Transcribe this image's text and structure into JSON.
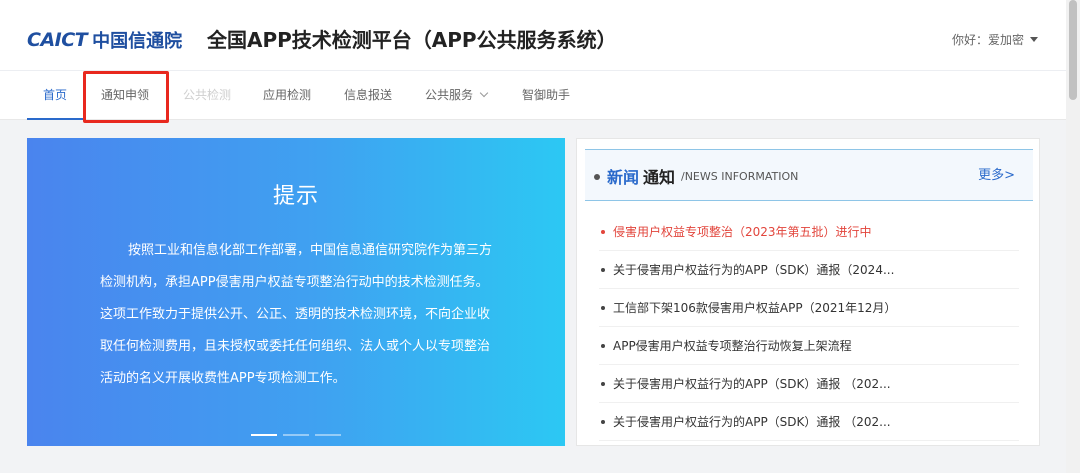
{
  "header": {
    "logo_latin": "CAICT",
    "logo_cn": "中国信通院",
    "title": "全国APP技术检测平台（APP公共服务系统）",
    "user_greeting": "你好：爱加密"
  },
  "nav": {
    "items": [
      {
        "label": "首页",
        "state": "active"
      },
      {
        "label": "通知申领",
        "state": "highlighted"
      },
      {
        "label": "公共检测",
        "state": "disabled"
      },
      {
        "label": "应用检测",
        "state": "normal"
      },
      {
        "label": "信息报送",
        "state": "normal"
      },
      {
        "label": "公共服务",
        "state": "dropdown"
      },
      {
        "label": "智御助手",
        "state": "normal"
      }
    ],
    "highlight_color": "#e8281e"
  },
  "banner": {
    "title": "提示",
    "body": "按照工业和信息化部工作部署，中国信息通信研究院作为第三方检测机构，承担APP侵害用户权益专项整治行动中的技术检测任务。这项工作致力于提供公开、公正、透明的技术检测环境，不向企业收取任何检测费用，且未授权或委托任何组织、法人或个人以专项整治活动的名义开展收费性APP专项检测工作。",
    "gradient_start": "#4a84ee",
    "gradient_end": "#2cc8f3"
  },
  "news": {
    "title_accent": "新闻",
    "title_rest": "通知",
    "title_en": "/NEWS INFORMATION",
    "more": "更多>",
    "items": [
      {
        "text": "侵害用户权益专项整治（2023年第五批）进行中",
        "hot": true
      },
      {
        "text": "关于侵害用户权益行为的APP（SDK）通报（2024..."
      },
      {
        "text": "工信部下架106款侵害用户权益APP（2021年12月）"
      },
      {
        "text": "APP侵害用户权益专项整治行动恢复上架流程"
      },
      {
        "text": "关于侵害用户权益行为的APP（SDK）通报 （202..."
      },
      {
        "text": "关于侵害用户权益行为的APP（SDK）通报 （202..."
      }
    ]
  },
  "colors": {
    "brand_blue": "#2a6acb",
    "hot_red": "#e2453c"
  }
}
